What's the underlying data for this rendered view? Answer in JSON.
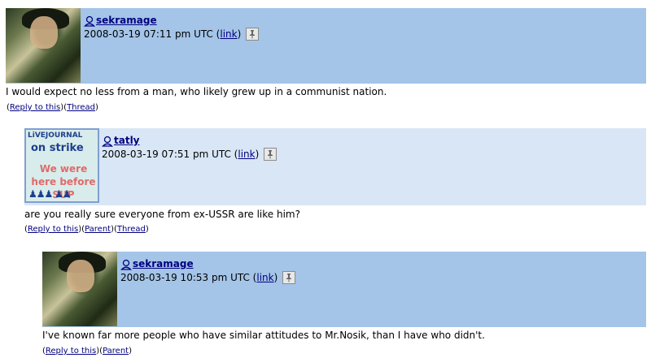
{
  "comments": [
    {
      "username": "sekramage",
      "date": "2008-03-19 07:11 pm UTC",
      "link_label": "link",
      "body": "I would expect no less from a man, who likely grew up in a communist nation.",
      "actions": [
        "Reply to this",
        "Thread"
      ],
      "header_color": "#a4c4e8"
    },
    {
      "username": "tatly",
      "date": "2008-03-19 07:51 pm UTC",
      "link_label": "link",
      "body": "are you really sure everyone from ex-USSR are like him?",
      "actions": [
        "Reply to this",
        "Parent",
        "Thread"
      ],
      "header_color": "#d8e6f6",
      "userpic": {
        "brand": "LiVEJOURNAL",
        "line1": "on strike",
        "line2": "We were here before SUP",
        "figures": "♟♟♟ ♟♟"
      }
    },
    {
      "username": "sekramage",
      "date": "2008-03-19 10:53 pm UTC",
      "link_label": "link",
      "body": "I've known far more people who have similar attitudes to Mr.Nosik, than I have who didn't.",
      "actions": [
        "Reply to this",
        "Parent"
      ],
      "header_color": "#a4c4e8"
    }
  ],
  "icons": {
    "user": "user-icon",
    "pin": "pushpin-icon"
  }
}
